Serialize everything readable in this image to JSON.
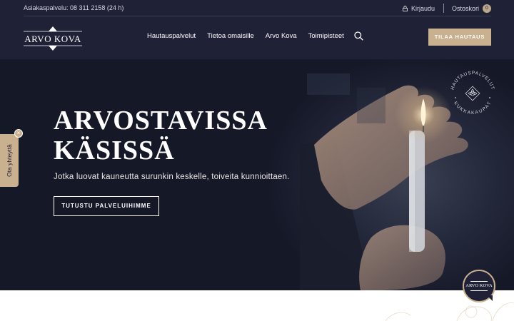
{
  "topbar": {
    "phone": "Asiakaspalvelu: 08 311 2158 (24 h)",
    "login_label": "Kirjaudu",
    "cart_label": "Ostoskori",
    "cart_count": "0"
  },
  "header": {
    "logo_text": "ARVO KOVA",
    "nav": [
      {
        "label": "Hautauspalvelut"
      },
      {
        "label": "Tietoa omaisille"
      },
      {
        "label": "Arvo Kova"
      },
      {
        "label": "Toimipisteet"
      }
    ],
    "cta_label": "TILAA HAUTAUS"
  },
  "hero": {
    "title_line1": "ARVOSTAVISSA",
    "title_line2": "KÄSISSÄ",
    "subtitle": "Jotka luovat kauneutta surunkin keskelle, toiveita kunnioittaen.",
    "button_label": "TUTUSTU PALVELUIHIMME",
    "badge_top": "HAUTAUSPALVELUT",
    "badge_bottom": "KUKKAKAUPAT"
  },
  "side_tab": {
    "label": "Ota yhteyttä",
    "close": "×"
  },
  "chat_widget": {
    "label": "ARVO KOVA"
  },
  "colors": {
    "navy": "#1f2136",
    "gold": "#c9b08f",
    "white": "#ffffff"
  }
}
